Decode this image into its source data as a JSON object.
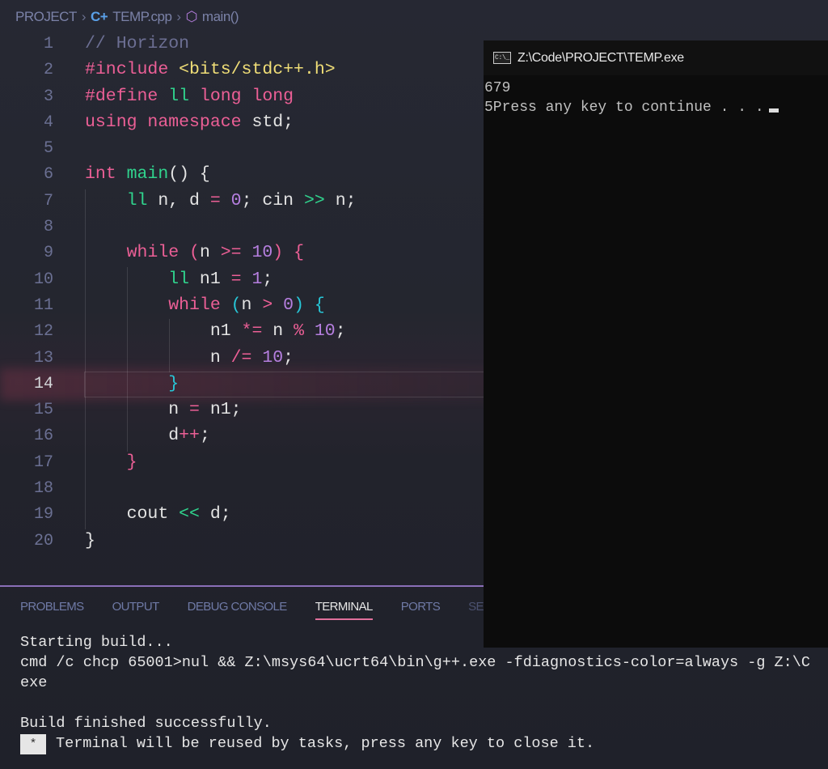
{
  "breadcrumb": {
    "project": "PROJECT",
    "file": "TEMP.cpp",
    "symbol": "main()"
  },
  "colors": {
    "keyword": "#ec5f96",
    "type": "#30d38d",
    "string": "#f0de77",
    "number": "#b67fe0",
    "comment": "#6c6f93",
    "accent": "#e0709c"
  },
  "code": {
    "current_line": 14,
    "lines": [
      [
        [
          "// Horizon",
          "c"
        ]
      ],
      [
        [
          "#include ",
          "k"
        ],
        [
          "<bits/stdc++.h>",
          "s"
        ]
      ],
      [
        [
          "#define ",
          "k"
        ],
        [
          "ll",
          "t"
        ],
        [
          " long long",
          "k"
        ]
      ],
      [
        [
          "using namespace ",
          "k"
        ],
        [
          "std;",
          "p"
        ]
      ],
      [],
      [
        [
          "int ",
          "k"
        ],
        [
          "main",
          "t"
        ],
        [
          "() {",
          "p"
        ]
      ],
      [
        [
          "    ",
          "p"
        ],
        [
          "ll",
          "t"
        ],
        [
          " n, d ",
          "p"
        ],
        [
          "=",
          "o"
        ],
        [
          " ",
          "p"
        ],
        [
          "0",
          "n"
        ],
        [
          "; cin ",
          "p"
        ],
        [
          ">>",
          "g"
        ],
        [
          " n;",
          "p"
        ]
      ],
      [],
      [
        [
          "    ",
          "p"
        ],
        [
          "while ",
          "k"
        ],
        [
          "(",
          "k"
        ],
        [
          "n ",
          "p"
        ],
        [
          ">=",
          "o"
        ],
        [
          " ",
          "p"
        ],
        [
          "10",
          "n"
        ],
        [
          ") {",
          "k"
        ]
      ],
      [
        [
          "        ",
          "p"
        ],
        [
          "ll",
          "t"
        ],
        [
          " n1 ",
          "p"
        ],
        [
          "=",
          "o"
        ],
        [
          " ",
          "p"
        ],
        [
          "1",
          "n"
        ],
        [
          ";",
          "p"
        ]
      ],
      [
        [
          "        ",
          "p"
        ],
        [
          "while ",
          "k"
        ],
        [
          "(",
          "b"
        ],
        [
          "n ",
          "p"
        ],
        [
          ">",
          "o"
        ],
        [
          " ",
          "p"
        ],
        [
          "0",
          "n"
        ],
        [
          ") {",
          "b"
        ]
      ],
      [
        [
          "            n1 ",
          "p"
        ],
        [
          "*=",
          "o"
        ],
        [
          " n ",
          "p"
        ],
        [
          "%",
          "o"
        ],
        [
          " ",
          "p"
        ],
        [
          "10",
          "n"
        ],
        [
          ";",
          "p"
        ]
      ],
      [
        [
          "            n ",
          "p"
        ],
        [
          "/=",
          "o"
        ],
        [
          " ",
          "p"
        ],
        [
          "10",
          "n"
        ],
        [
          ";",
          "p"
        ]
      ],
      [
        [
          "        ",
          "p"
        ],
        [
          "}",
          "b"
        ]
      ],
      [
        [
          "        n ",
          "p"
        ],
        [
          "=",
          "o"
        ],
        [
          " n1;",
          "p"
        ]
      ],
      [
        [
          "        d",
          "p"
        ],
        [
          "++",
          "o"
        ],
        [
          ";",
          "p"
        ]
      ],
      [
        [
          "    ",
          "p"
        ],
        [
          "}",
          "k"
        ]
      ],
      [],
      [
        [
          "    cout ",
          "p"
        ],
        [
          "<<",
          "g"
        ],
        [
          " d;",
          "p"
        ]
      ],
      [
        [
          "}",
          "p"
        ]
      ]
    ]
  },
  "console": {
    "title": "Z:\\Code\\PROJECT\\TEMP.exe",
    "lines": [
      "679",
      "5Press any key to continue . . ."
    ]
  },
  "panel": {
    "tabs": [
      "PROBLEMS",
      "OUTPUT",
      "DEBUG CONSOLE",
      "TERMINAL",
      "PORTS",
      "SEARCH ERROR"
    ],
    "active": "TERMINAL"
  },
  "terminal": {
    "lines": [
      "Starting build...",
      "cmd /c chcp 65001>nul && Z:\\msys64\\ucrt64\\bin\\g++.exe -fdiagnostics-color=always -g Z:\\C",
      "exe",
      "",
      "Build finished successfully."
    ],
    "prompt_badge": "*",
    "prompt_text": "Terminal will be reused by tasks, press any key to close it."
  }
}
